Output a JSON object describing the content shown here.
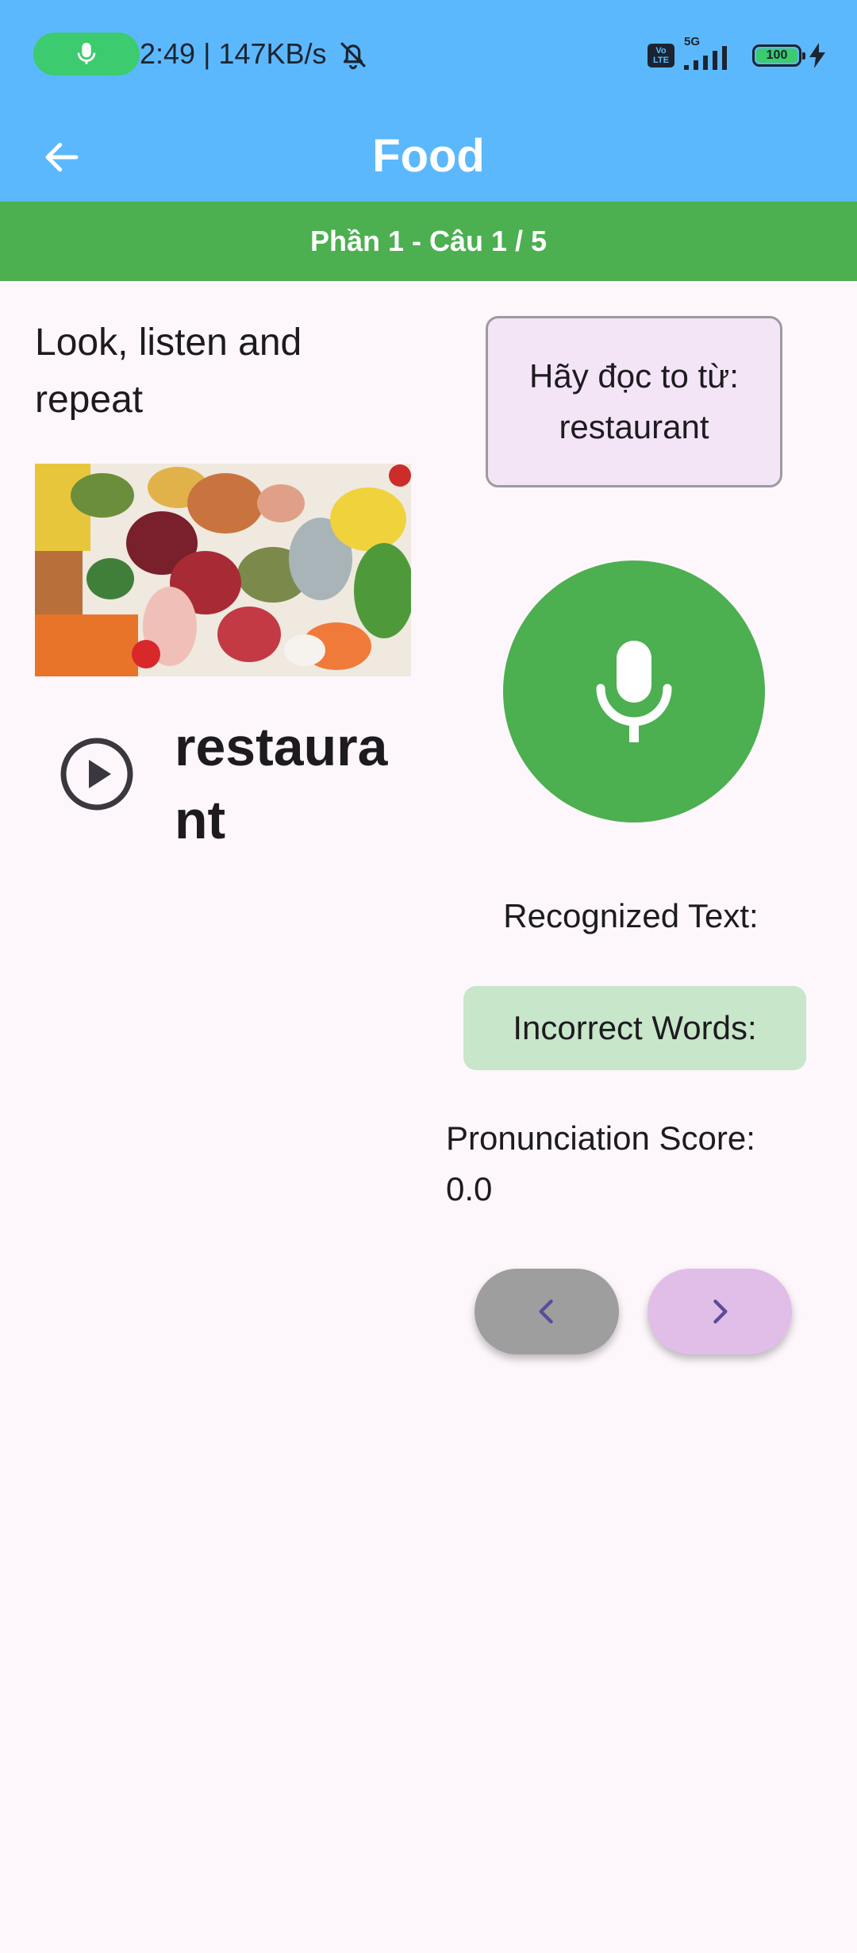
{
  "status_bar": {
    "time_speed": "2:49 | 147KB/s",
    "battery_level": "100",
    "network": "5G",
    "volte_label": "Vo LTE",
    "accent_color": "#3CCB6E"
  },
  "app_bar": {
    "title": "Food",
    "back_icon": "arrow-left-icon",
    "background_color": "#5CB8FC"
  },
  "progress": {
    "label": "Phần 1 - Câu 1 / 5",
    "background_color": "#4CAF50"
  },
  "lesson": {
    "instruction": "Look, listen and repeat",
    "image_subject": "assorted food groceries",
    "word": "restaurant",
    "play_icon": "play-circle-icon"
  },
  "prompt": {
    "line1": "Hãy đọc to từ:",
    "line2": "restaurant"
  },
  "mic": {
    "icon": "microphone-icon",
    "color": "#4CAF50"
  },
  "results": {
    "recognized_label": "Recognized Text:",
    "incorrect_label": "Incorrect Words:",
    "score_label": "Pronunciation Score:",
    "score_value": "0.0"
  },
  "navigation": {
    "prev_icon": "chevron-left-icon",
    "next_icon": "chevron-right-icon"
  }
}
